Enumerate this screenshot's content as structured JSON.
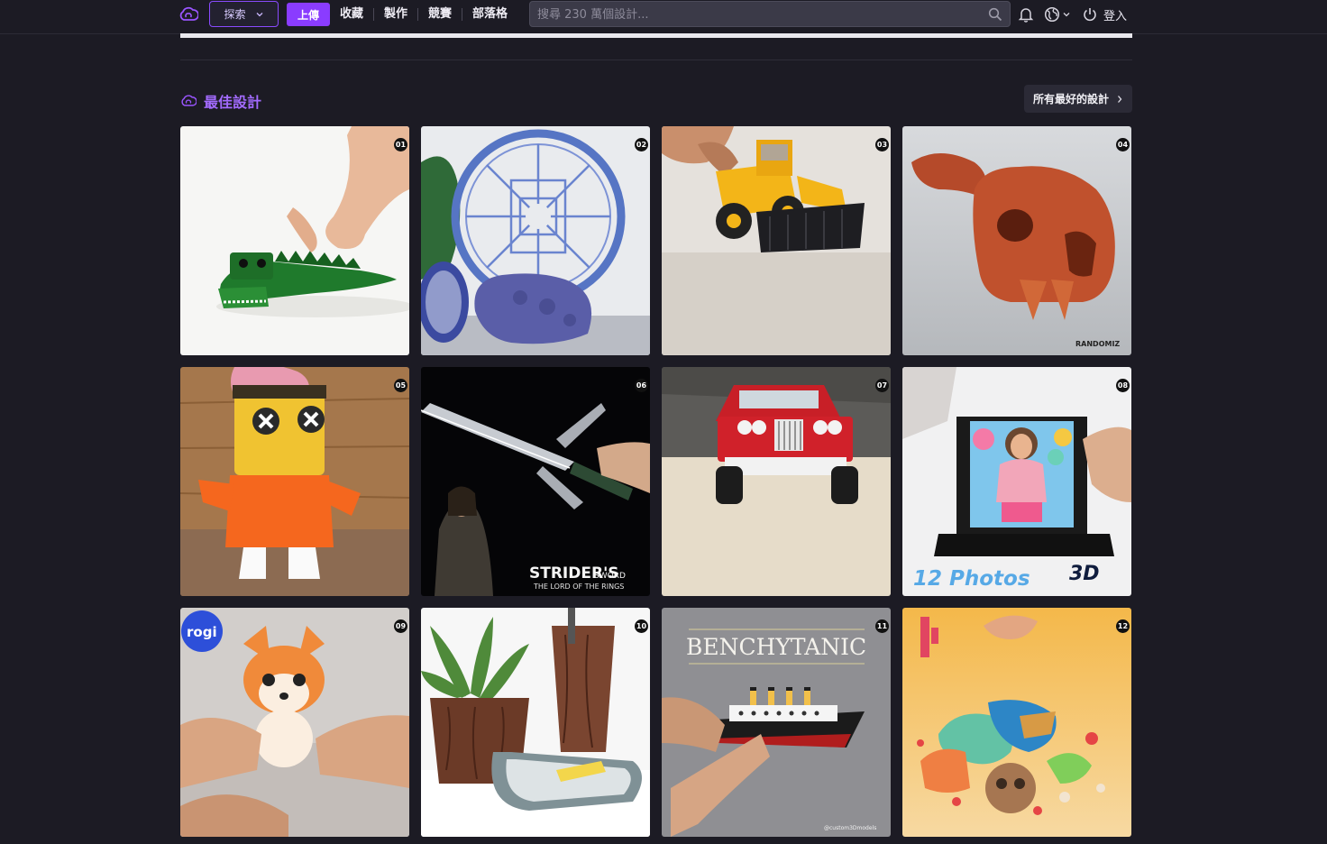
{
  "header": {
    "explore_label": "探索",
    "upload_label": "上傳",
    "nav": [
      "收藏",
      "製作",
      "競賽",
      "部落格"
    ],
    "search_placeholder": "搜尋 230 萬個設計...",
    "login_label": "登入",
    "accent_color": "#8a3cff"
  },
  "section": {
    "title": "最佳設計",
    "all_link": "所有最好的設計"
  },
  "designs": [
    {
      "rank": "01",
      "subject": "green crocodile toy"
    },
    {
      "rank": "02",
      "subject": "circular labyrinth sculpture"
    },
    {
      "rank": "03",
      "subject": "yellow wheel loader"
    },
    {
      "rank": "04",
      "subject": "terracotta skull",
      "watermark": "RANDOMIZ"
    },
    {
      "rank": "05",
      "subject": "yellow cylinder character"
    },
    {
      "rank": "06",
      "subject": "sword",
      "caption_1": "STRIDER'S",
      "caption_2": "SWORD",
      "caption_3": "THE LORD OF THE RINGS"
    },
    {
      "rank": "07",
      "subject": "red off-road truck"
    },
    {
      "rank": "08",
      "subject": "photo flip frame",
      "caption_1": "12 Photos",
      "caption_2": "3D"
    },
    {
      "rank": "09",
      "subject": "fox figurine",
      "caption_1": "rogi"
    },
    {
      "rank": "10",
      "subject": "bark planters and tray"
    },
    {
      "rank": "11",
      "subject": "ship model",
      "caption_1": "BENCHYTANIC",
      "caption_2": "@custom3Dmodels"
    },
    {
      "rank": "12",
      "subject": "flexi toys"
    }
  ]
}
